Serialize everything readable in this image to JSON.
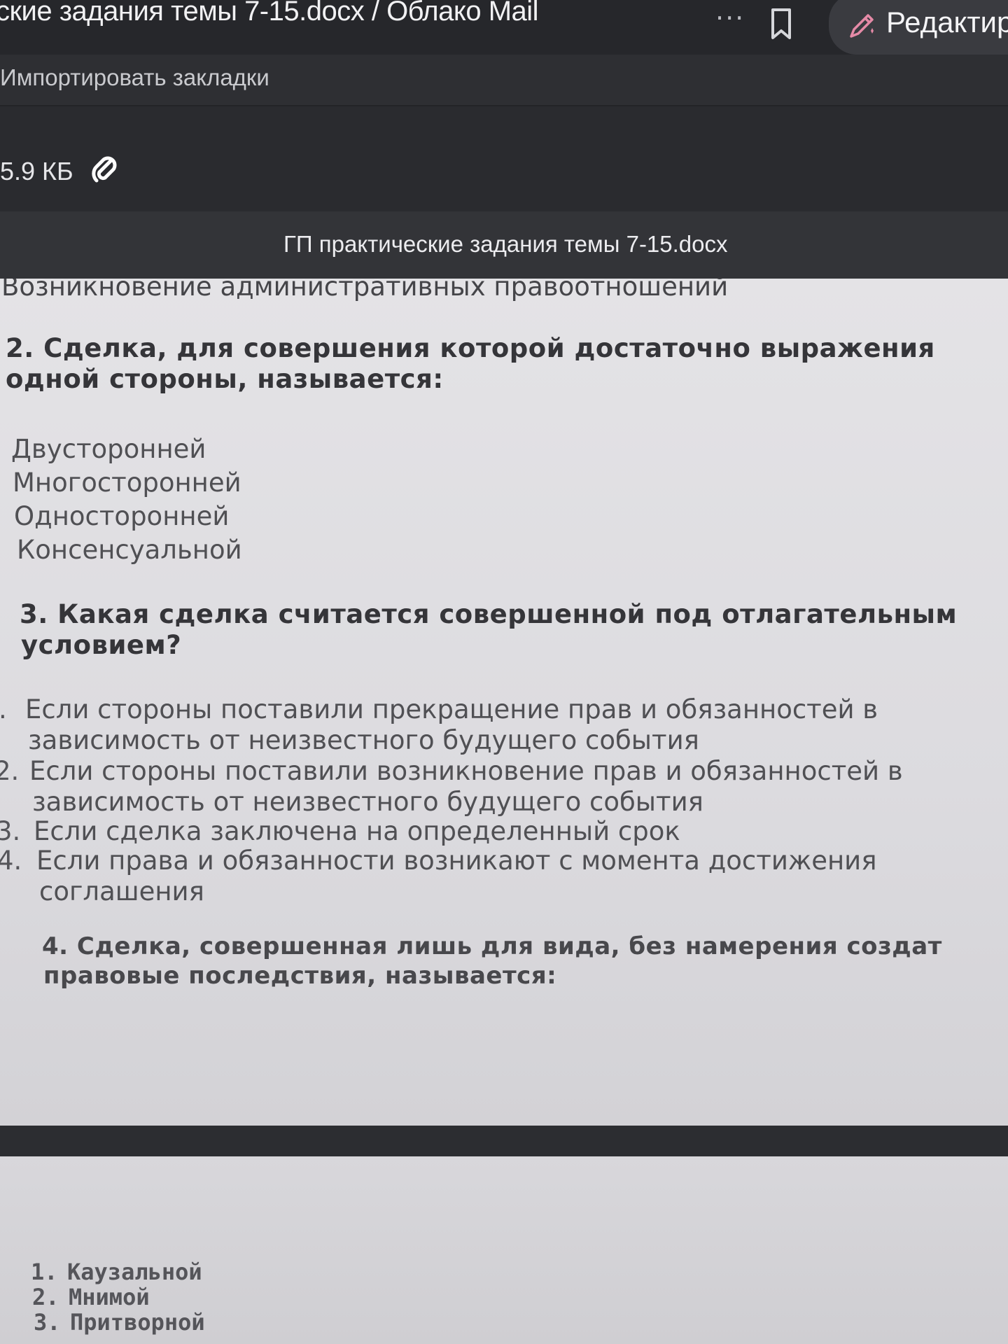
{
  "browser": {
    "tab_title": "ские задания темы 7-15.docx / Облако Mail",
    "more_label": "···",
    "edit_label": "Редактир",
    "bookmarks_import": "Импортировать закладки"
  },
  "file": {
    "size": "5.9 КБ",
    "doc_name": "ГП практические задания темы 7-15.docx"
  },
  "document": {
    "intro_line": "Возникновение административных правоотношений",
    "q2": {
      "line1": "2. Сделка, для совершения которой достаточно выражения",
      "line2": "одной стороны, называется:",
      "options": [
        "Двусторонней",
        "Многосторонней",
        "Односторонней",
        "Консенсуальной"
      ]
    },
    "q3": {
      "line1": "3. Какая сделка считается совершенной под отлагательным",
      "line2": "условием?",
      "options": [
        {
          "num": ".",
          "line1": "Если стороны поставили прекращение прав и обязанностей в",
          "line2": "зависимость от неизвестного будущего события"
        },
        {
          "num": "2.",
          "line1": "Если стороны поставили возникновение прав и обязанностей в",
          "line2": "зависимость от неизвестного будущего события"
        },
        {
          "num": "3.",
          "line1": "Если сделка заключена на определенный срок",
          "line2": ""
        },
        {
          "num": "4.",
          "line1": "Если права и обязанности возникают с момента достижения",
          "line2": "соглашения"
        }
      ]
    },
    "q4": {
      "line1": "4. Сделка, совершенная лишь для вида, без намерения создат",
      "line2": "правовые последствия, называется:"
    },
    "q4_options": [
      {
        "num": "1.",
        "text": "Каузальной"
      },
      {
        "num": "2.",
        "text": "Мнимой"
      },
      {
        "num": "3.",
        "text": "Притворной"
      }
    ]
  }
}
